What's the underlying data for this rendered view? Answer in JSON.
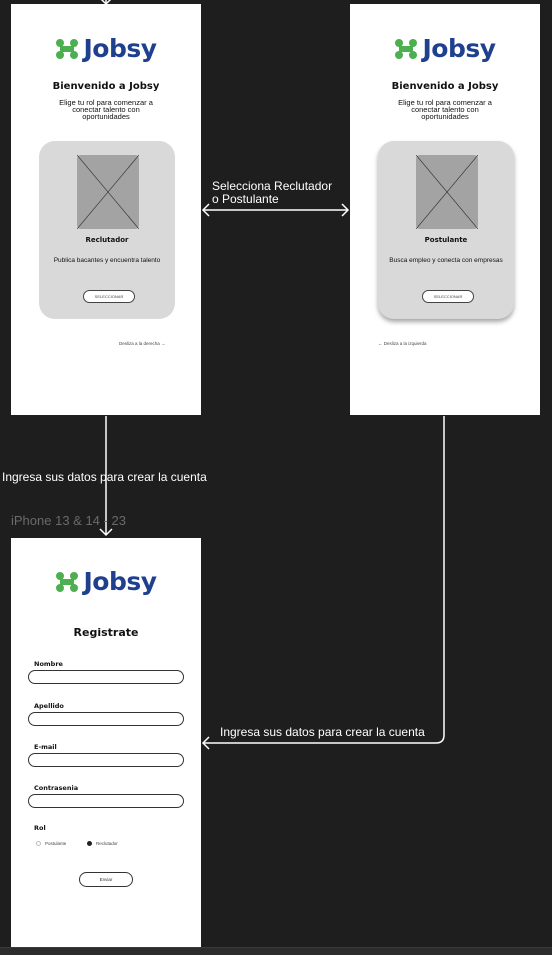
{
  "screens": {
    "recruiter": {
      "logo": "Jobsy",
      "title": "Bienvenido a Jobsy",
      "subtitle": "Elige tu rol para comenzar a conectar talento con oportunidades",
      "card": {
        "title": "Reclutador",
        "description": "Publica bacantes y encuentra talento",
        "button": "SELECCIONAR"
      },
      "swipe_hint": "Desliza a la derecha →"
    },
    "applicant": {
      "logo": "Jobsy",
      "title": "Bienvenido a Jobsy",
      "subtitle": "Elige tu rol para comenzar a conectar talento con oportunidades",
      "card": {
        "title": "Postulante",
        "description": "Busca empleo y conecta con empresas",
        "button": "SELECCIONAR"
      },
      "swipe_hint": "← Desliza a la izquierda"
    },
    "register": {
      "frame_label": "iPhone 13 & 14 - 23",
      "logo": "Jobsy",
      "title": "Registrate",
      "fields": [
        {
          "label": "Nombre",
          "value": ""
        },
        {
          "label": "Apellido",
          "value": ""
        },
        {
          "label": "E-mail",
          "value": ""
        },
        {
          "label": "Contrasenia",
          "value": ""
        }
      ],
      "role_label": "Rol",
      "roles": [
        {
          "label": "Postulante",
          "selected": false
        },
        {
          "label": "Reclutador",
          "selected": true
        }
      ],
      "submit": "Enviar"
    }
  },
  "flows": {
    "swap": "Selecciona Reclutador o Postulante",
    "register_left": "Ingresa sus datos para crear la cuenta",
    "register_right": "Ingresa sus datos para crear la cuenta"
  },
  "colors": {
    "canvas": "#1e1e1e",
    "logo_green": "#4caf50",
    "logo_blue": "#1f3f8f",
    "card": "#d9d9d9",
    "placeholder": "#a3a3a3",
    "connector": "#ffffff"
  }
}
